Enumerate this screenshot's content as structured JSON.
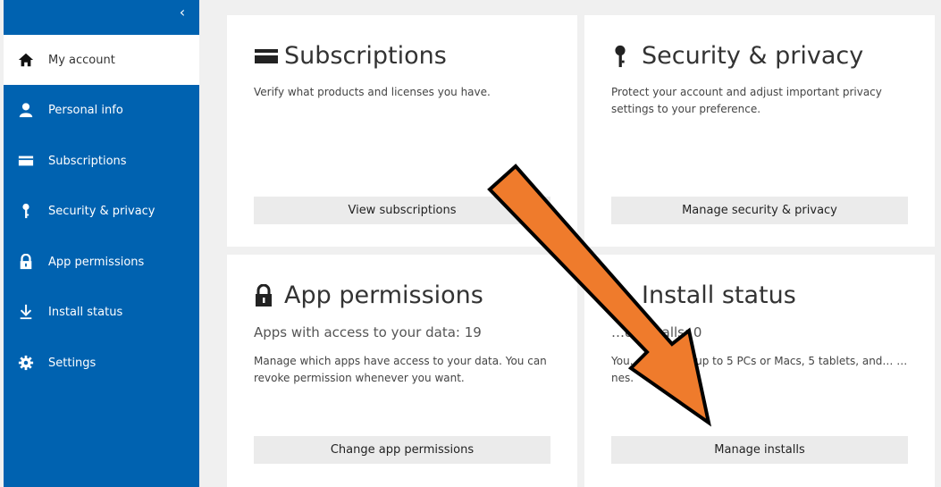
{
  "sidebar": {
    "collapse_glyph": "‹",
    "items": [
      {
        "label": "My account",
        "icon": "home-icon",
        "active": true
      },
      {
        "label": "Personal info",
        "icon": "person-icon"
      },
      {
        "label": "Subscriptions",
        "icon": "card-icon"
      },
      {
        "label": "Security & privacy",
        "icon": "key-icon"
      },
      {
        "label": "App permissions",
        "icon": "lock-icon"
      },
      {
        "label": "Install status",
        "icon": "download-icon"
      },
      {
        "label": "Settings",
        "icon": "gear-icon"
      }
    ]
  },
  "cards": {
    "subscriptions": {
      "title": "Subscriptions",
      "icon": "card-icon",
      "description": "Verify what products and licenses you have.",
      "button": "View subscriptions"
    },
    "security": {
      "title": "Security & privacy",
      "icon": "key-icon",
      "description": "Protect your account and adjust important privacy settings to your preference.",
      "button": "Manage security & privacy"
    },
    "app_permissions": {
      "title": "App permissions",
      "icon": "lock-icon",
      "subtitle": "Apps with access to your data: 19",
      "description": "Manage which apps have access to your data. You can revoke permission whenever you want.",
      "button": "Change app permissions"
    },
    "install_status": {
      "title": "Install status",
      "icon": "download-icon",
      "subtitle": "…d installs: 0",
      "description": "You… Office on up to 5 PCs or Macs, 5 tablets, and… …nes.",
      "button": "Manage installs"
    }
  },
  "annotation": {
    "arrow_color": "#ef7b2c",
    "arrow_outline": "#000000"
  },
  "colors": {
    "sidebar_bg": "#0062b0",
    "page_bg": "#f0f0f0",
    "card_bg": "#ffffff",
    "button_bg": "#ebebeb"
  }
}
